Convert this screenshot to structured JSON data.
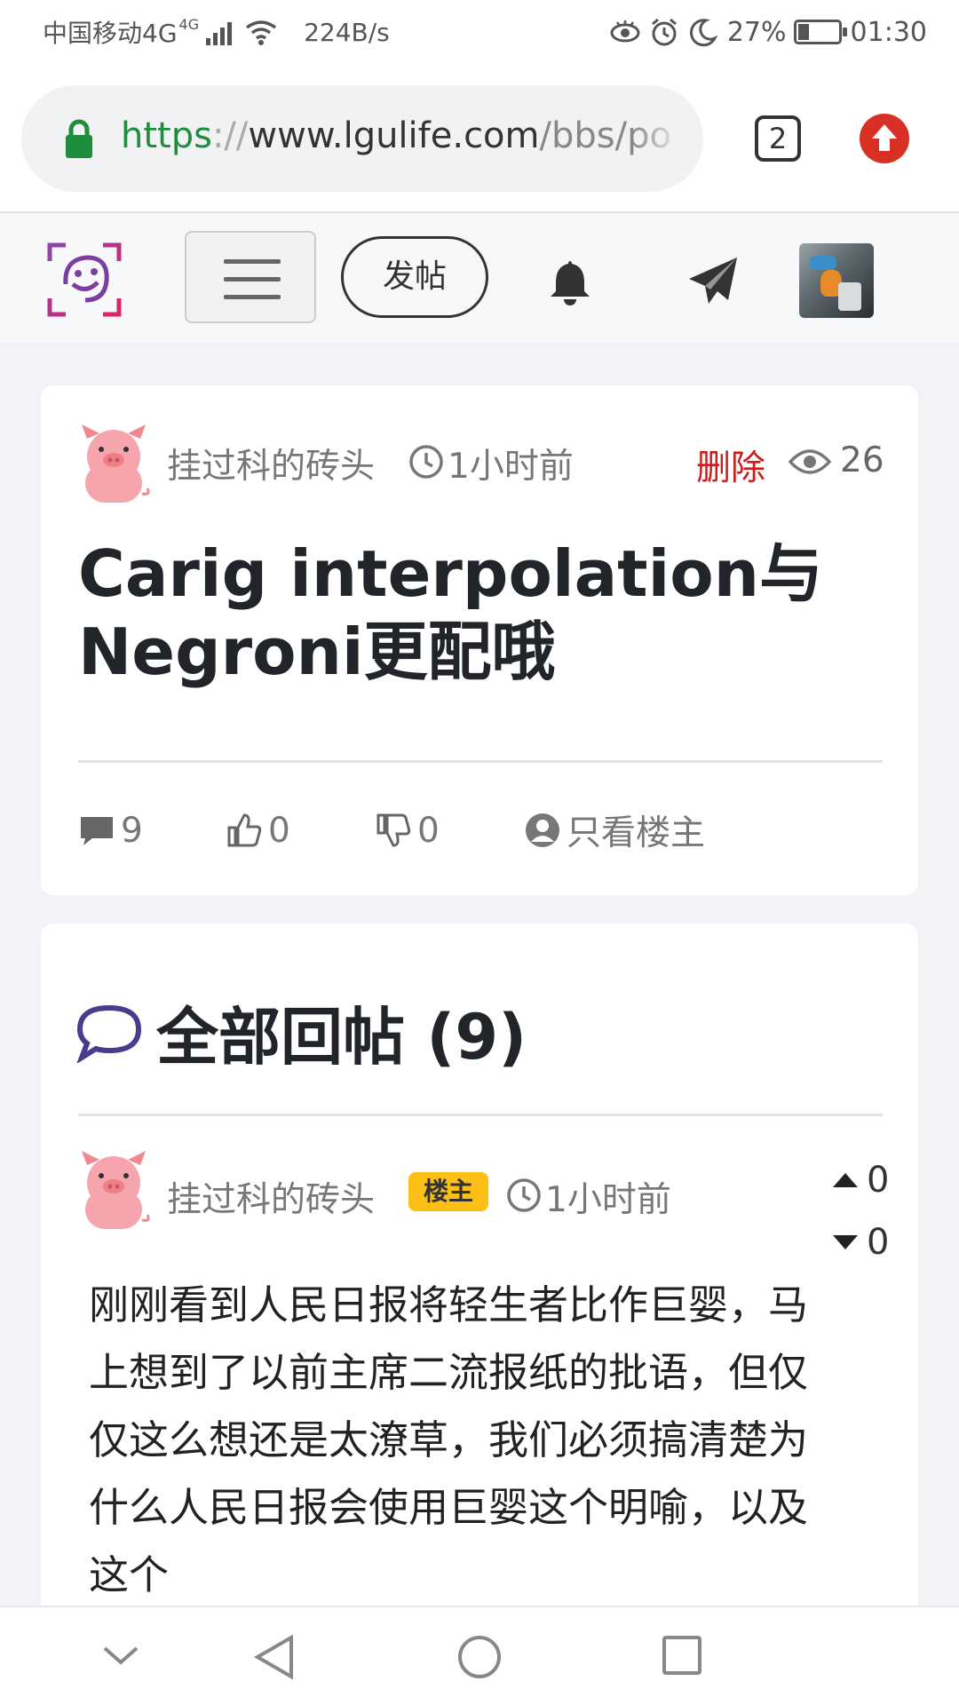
{
  "status_bar": {
    "carrier": "中国移动4G",
    "network_badge": "4G",
    "speed": "224B/s",
    "battery": "27%",
    "battery_level": 0.27,
    "time": "01:30"
  },
  "browser": {
    "url_scheme": "https",
    "url_sep": "://",
    "url_host": "www.lgulife.com",
    "url_path": "/bbs/po",
    "tab_count": "2"
  },
  "nav": {
    "post_button": "发帖"
  },
  "post": {
    "author": "挂过科的砖头",
    "time": "1小时前",
    "delete_label": "删除",
    "views": "26",
    "title": "Carig interpolation与Negroni更配哦",
    "comments": "9",
    "likes": "0",
    "dislikes": "0",
    "only_op_label": "只看楼主"
  },
  "replies": {
    "heading": "全部回帖 (9)",
    "items": [
      {
        "author": "挂过科的砖头",
        "badge": "楼主",
        "time": "1小时前",
        "upvotes": "0",
        "downvotes": "0",
        "body": "刚刚看到人民日报将轻生者比作巨婴，马上想到了以前主席二流报纸的批语，但仅仅这么想还是太潦草，我们必须搞清楚为什么人民日报会使用巨婴这个明喻，以及这个"
      }
    ]
  },
  "colors": {
    "delete": "#cc1d1d",
    "badge": "#fcbf16",
    "secure_green": "#1e8e3e",
    "update_red": "#d93025"
  }
}
